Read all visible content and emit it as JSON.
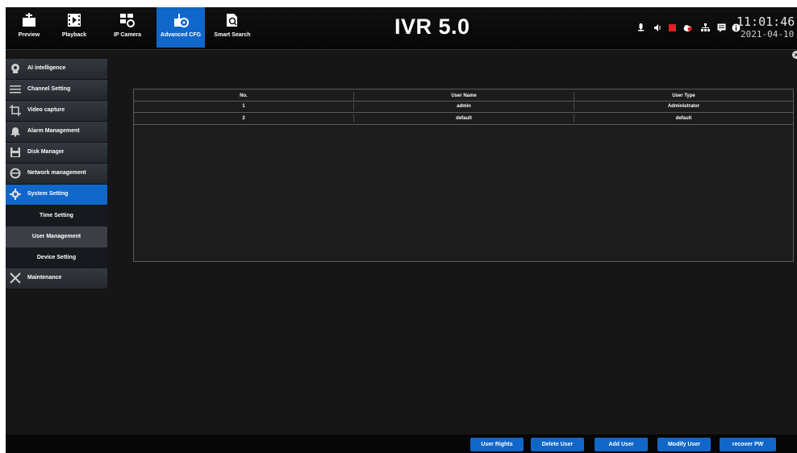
{
  "header": {
    "title": "IVR 5.0",
    "time": "11:01:46",
    "date": "2021-04-10",
    "nav": [
      {
        "label": "Preview",
        "icon": "preview-icon"
      },
      {
        "label": "Playback",
        "icon": "playback-icon"
      },
      {
        "label": "IP Camera",
        "icon": "ip-camera-icon"
      },
      {
        "label": "Advanced CFG",
        "icon": "advanced-cfg-icon",
        "active": true
      },
      {
        "label": "Smart Search",
        "icon": "smart-search-icon"
      }
    ],
    "status_icons": [
      "microphone-icon",
      "speaker-icon",
      "record-icon",
      "cloud-icon",
      "network-icon",
      "message-icon",
      "info-icon"
    ],
    "accent": "#1167c9"
  },
  "sidebar": {
    "items": [
      {
        "label": "AI intelligence",
        "icon": "ai-icon"
      },
      {
        "label": "Channel Setting",
        "icon": "channel-list-icon"
      },
      {
        "label": "Video capture",
        "icon": "crop-icon"
      },
      {
        "label": "Alarm Management",
        "icon": "bell-icon"
      },
      {
        "label": "Disk Manager",
        "icon": "disk-icon"
      },
      {
        "label": "Network management",
        "icon": "internet-icon"
      },
      {
        "label": "System Setting",
        "icon": "gear-icon",
        "active": true
      },
      {
        "label": "Maintenance",
        "icon": "tools-icon"
      }
    ],
    "subitems": [
      {
        "label": "Time Setting"
      },
      {
        "label": "User Management",
        "active": true
      },
      {
        "label": "Device Setting"
      }
    ]
  },
  "table": {
    "columns": [
      "No.",
      "User Name",
      "User Type"
    ],
    "rows": [
      [
        "1",
        "admin",
        "Administrator"
      ],
      [
        "2",
        "default",
        "default"
      ]
    ]
  },
  "buttons": {
    "user_rights": "User Rights",
    "delete_user": "Delete User",
    "add_user": "Add User",
    "modify_user": "Modify User",
    "recover_pw": "recover PW"
  }
}
